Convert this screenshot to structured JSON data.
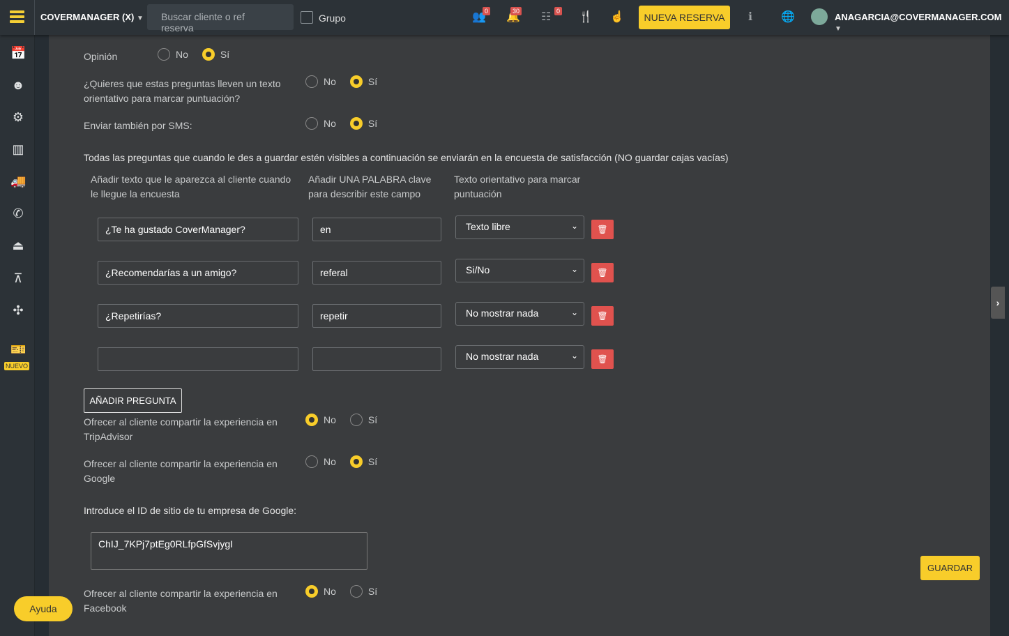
{
  "header": {
    "brand": "COVERMANAGER (X)",
    "search_placeholder": "Buscar cliente o ref reserva",
    "group_label": "Grupo",
    "badges": {
      "clients": "0",
      "notifications": "30",
      "tasks": "0"
    },
    "new_booking": "NUEVA RESERVA",
    "user_email": "ANAGARCIA@COVERMANAGER.COM"
  },
  "sidebar": {
    "new_badge": "NUEVO"
  },
  "form": {
    "no": "No",
    "yes": "Sí",
    "opinion": {
      "label": "Opinión",
      "value": "yes"
    },
    "orientative": {
      "label": "¿Quieres que estas preguntas lleven un texto orientativo para marcar puntuación?",
      "value": "yes"
    },
    "sms": {
      "label": "Enviar también por SMS:",
      "value": "yes"
    },
    "info": "Todas las preguntas que cuando le des a guardar estén visibles a continuación se enviarán en la encuesta de satisfacción (NO guardar cajas vacías)",
    "columns": [
      "Añadir texto que le aparezca al cliente cuando le llegue la encuesta",
      "Añadir UNA PALABRA clave para describir este campo",
      "Texto orientativo para marcar puntuación"
    ],
    "questions": [
      {
        "text": "¿Te ha gustado CoverManager?",
        "key": "en",
        "type": "Texto libre"
      },
      {
        "text": "¿Recomendarías a un amigo?",
        "key": "referal",
        "type": "Si/No"
      },
      {
        "text": "¿Repetirías?",
        "key": "repetir",
        "type": "No mostrar nada"
      },
      {
        "text": "",
        "key": "",
        "type": "No mostrar nada"
      }
    ],
    "add_question": "AÑADIR PREGUNTA",
    "tripadvisor": {
      "label": "Ofrecer al cliente compartir la experiencia en TripAdvisor",
      "value": "no"
    },
    "google": {
      "label": "Ofrecer al cliente compartir la experiencia en Google",
      "value": "yes"
    },
    "google_id_label": "Introduce el ID de sitio de tu empresa de Google:",
    "google_id": "ChIJ_7KPj7ptEg0RLfpGfSvjygI",
    "facebook": {
      "label": "Ofrecer al cliente compartir la experiencia en Facebook",
      "value": "no"
    },
    "save": "GUARDAR"
  },
  "help": "Ayuda",
  "colors": {
    "accent": "#f8cd2a",
    "danger": "#e0524e"
  }
}
